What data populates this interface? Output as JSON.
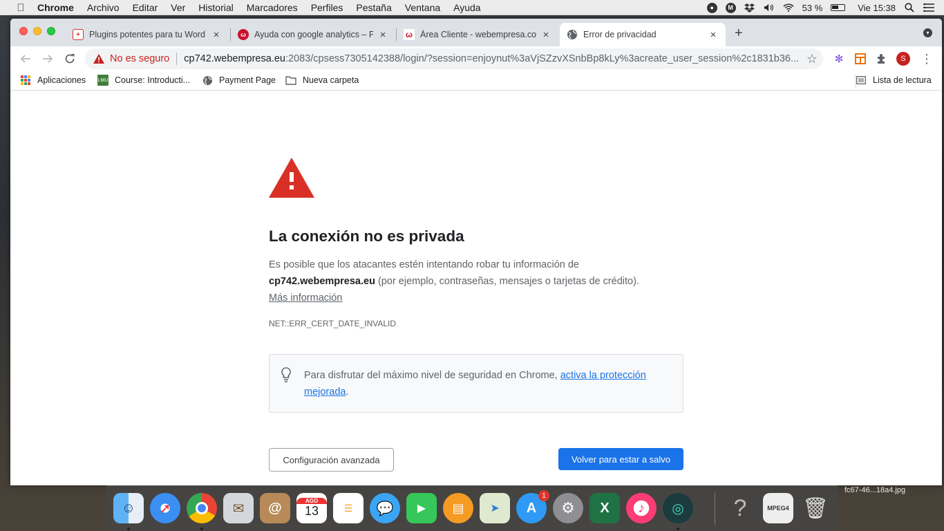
{
  "menubar": {
    "apple": "",
    "items": [
      "Chrome",
      "Archivo",
      "Editar",
      "Ver",
      "Historial",
      "Marcadores",
      "Perfiles",
      "Pestaña",
      "Ventana",
      "Ayuda"
    ],
    "battery_percent": "53 %",
    "clock": "Vie 15:38"
  },
  "tabs": [
    {
      "title": "Plugins potentes para tu Word",
      "favicon": "bracket-plugin-icon",
      "active": false
    },
    {
      "title": "Ayuda con google analytics – P",
      "favicon": "webempresa-icon",
      "active": false
    },
    {
      "title": "Área Cliente - webempresa.com",
      "favicon": "webempresa-w-icon",
      "active": false
    },
    {
      "title": "Error de privacidad",
      "favicon": "globe-icon",
      "active": true
    }
  ],
  "omnibox": {
    "security_label": "No es seguro",
    "url_host": "cp742.webempresa.eu",
    "url_rest": ":2083/cpsess7305142388/login/?session=enjoynut%3aVjSZzvXSnbBp8kLy%3acreate_user_session%2c1831b36..."
  },
  "bookmarks": {
    "items": [
      {
        "label": "Aplicaciones",
        "icon": "apps-grid-icon"
      },
      {
        "label": "Course: Introducti...",
        "icon": "course-icon"
      },
      {
        "label": "Payment Page",
        "icon": "globe-icon"
      },
      {
        "label": "Nueva carpeta",
        "icon": "folder-icon"
      }
    ],
    "reading_list": "Lista de lectura"
  },
  "page": {
    "heading": "La conexión no es privada",
    "para_1": "Es posible que los atacantes estén intentando robar tu información de",
    "host_bold": "cp742.webempresa.eu",
    "para_2": " (por ejemplo, contraseñas, mensajes o tarjetas de crédito).",
    "more_info": "Más información",
    "error_code": "NET::ERR_CERT_DATE_INVALID",
    "tip_text": "Para disfrutar del máximo nivel de seguridad en Chrome, ",
    "tip_link": "activa la protección mejorada",
    "tip_end": ".",
    "advanced_button": "Configuración avanzada",
    "back_button": "Volver para estar a salvo"
  },
  "dock": {
    "apps": [
      "Finder",
      "Safari",
      "Chrome",
      "Mail",
      "Contacts",
      "Calendar",
      "Reminders",
      "Messages",
      "FaceTime",
      "Books",
      "Maps",
      "App Store",
      "System Preferences",
      "Excel",
      "iTunes",
      "Camtasia",
      "Help",
      "MPEG4",
      "Trash"
    ],
    "calendar_month": "AGO",
    "calendar_day": "13",
    "appstore_badge": "1"
  },
  "desktop_file": "fc67-46...18a4.jpg",
  "colors": {
    "accent": "#1a73e8",
    "warning_red": "#d93025",
    "insecure_text": "#c5221f"
  }
}
